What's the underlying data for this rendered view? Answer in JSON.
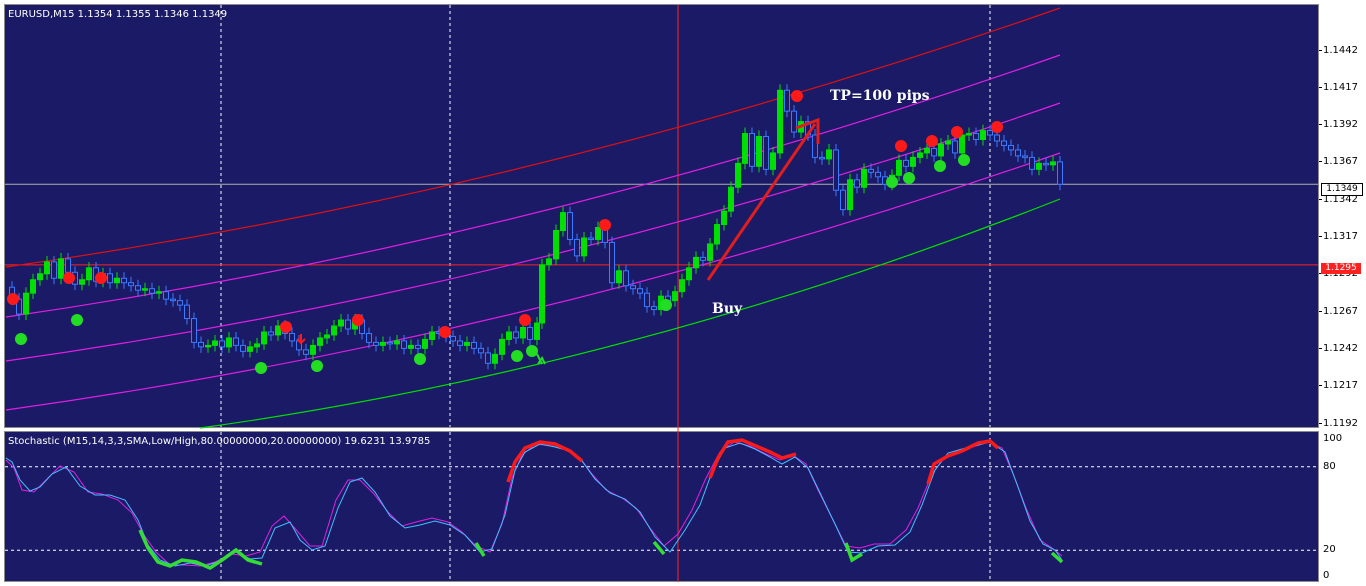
{
  "chart_header": "EURUSD,M15  1.1354 1.1355 1.1346 1.1349",
  "oscillator_header": "Stochastic (M15,14,3,3,SMA,Low/High,80.00000000,20.00000000) 19.6231 13.9785",
  "price_ticks": [
    "1.1442",
    "1.1417",
    "1.1392",
    "1.1367",
    "1.1342",
    "1.1317",
    "1.1292",
    "1.1267",
    "1.1242",
    "1.1217",
    "1.1192"
  ],
  "current_price": "1.1349",
  "horizontal_line_price": "1.1295",
  "oscillator_ticks": [
    "100",
    "80",
    "20",
    "0"
  ],
  "annotations": {
    "tp": "TP=100 pips",
    "buy": "Buy"
  },
  "colors": {
    "background": "#1a1a66",
    "bull_candle": "#00e000",
    "bear_candle": "#3a7bff",
    "upper_channel": "#e01010",
    "mid_channels": "#e020e0",
    "lower_channel": "#00e000",
    "sell_signal": "#ff1a1a",
    "buy_signal": "#22dd22",
    "stoch_main": "#40c0ff",
    "stoch_signal": "#e020e0",
    "hline": "#ff2020"
  },
  "icons": [
    "sell-dot-icon",
    "buy-dot-icon",
    "down-arrow-icon",
    "trend-arrow-icon"
  ]
}
